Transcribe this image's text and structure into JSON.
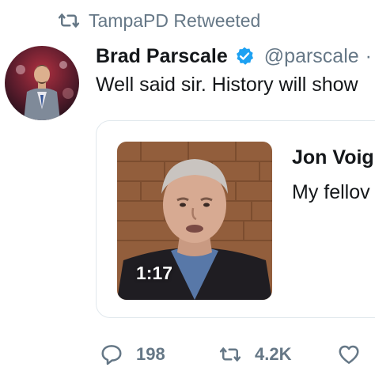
{
  "retweet_context": {
    "icon": "retweet-icon",
    "text": "TampaPD Retweeted"
  },
  "tweet": {
    "author_name": "Brad Parscale",
    "verified": true,
    "handle": "@parscale",
    "separator": "·",
    "text": "Well said sir. History will show",
    "avatar_icon": "avatar"
  },
  "quoted_tweet": {
    "author_name": "Jon Voig",
    "text": "My fellov",
    "video_duration": "1:17"
  },
  "actions": {
    "reply_count": "198",
    "retweet_count": "4.2K",
    "like_icon": "heart-icon"
  },
  "colors": {
    "text_primary": "#14171a",
    "text_secondary": "#657786",
    "verified_blue": "#1da1f2",
    "card_border": "#e1e8ed"
  }
}
